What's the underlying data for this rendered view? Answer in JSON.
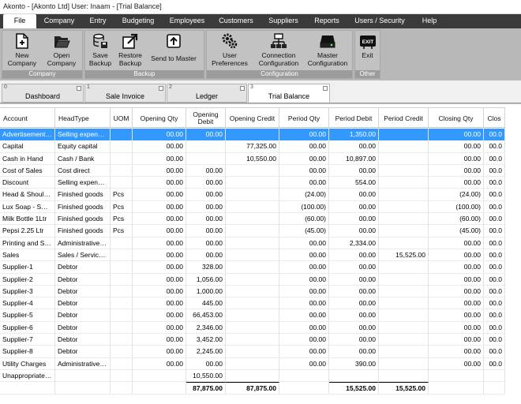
{
  "window": {
    "title": "Akonto - [Akonto Ltd]  User: Inaam - [Trial Balance]"
  },
  "menu": [
    {
      "label": "File",
      "active": true
    },
    {
      "label": "Company"
    },
    {
      "label": "Entry"
    },
    {
      "label": "Budgeting"
    },
    {
      "label": "Employees"
    },
    {
      "label": "Customers"
    },
    {
      "label": "Suppliers"
    },
    {
      "label": "Reports"
    },
    {
      "label": "Users / Security"
    },
    {
      "label": "Help"
    }
  ],
  "ribbon": {
    "groups": [
      {
        "caption": "Company",
        "buttons": [
          {
            "label": "New\nCompany",
            "icon": "new-company-icon"
          },
          {
            "label": "Open\nCompany",
            "icon": "open-folder-icon"
          }
        ]
      },
      {
        "caption": "Backup",
        "buttons": [
          {
            "label": "Save\nBackup",
            "icon": "database-save-icon"
          },
          {
            "label": "Restore\nBackup",
            "icon": "restore-arrow-icon"
          },
          {
            "label": "Send to Master",
            "icon": "send-upload-icon"
          }
        ]
      },
      {
        "caption": "Configuration",
        "buttons": [
          {
            "label": "User\nPreferences",
            "icon": "gears-icon"
          },
          {
            "label": "Connection\nConfiguration",
            "icon": "network-icon"
          },
          {
            "label": "Master\nConfiguration",
            "icon": "server-icon"
          }
        ]
      },
      {
        "caption": "Other",
        "buttons": [
          {
            "label": "Exit",
            "icon": "exit-sign-icon",
            "badge": "EXIT"
          }
        ]
      }
    ]
  },
  "tabs": [
    {
      "num": "0",
      "label": "Dashboard"
    },
    {
      "num": "1",
      "label": "Sale Invoice"
    },
    {
      "num": "2",
      "label": "Ledger"
    },
    {
      "num": "3",
      "label": "Trial Balance",
      "active": true
    }
  ],
  "grid": {
    "columns": [
      "Account",
      "HeadType",
      "UOM",
      "Opening Qty",
      "Opening\nDebit",
      "Opening Credit",
      "Period Qty",
      "Period Debit",
      "Period Credit",
      "Closing Qty",
      "Clos"
    ],
    "rows": [
      [
        "Advertisement Ex...",
        "Selling expenses",
        "",
        "00.00",
        "00.00",
        "",
        "00.00",
        "1,350.00",
        "",
        "00.00",
        "00.0"
      ],
      [
        "Capital",
        "Equity capital",
        "",
        "00.00",
        "",
        "77,325.00",
        "00.00",
        "00.00",
        "",
        "00.00",
        "00.0"
      ],
      [
        "Cash in Hand",
        "Cash / Bank",
        "",
        "00.00",
        "",
        "10,550.00",
        "00.00",
        "10,897.00",
        "",
        "00.00",
        "00.0"
      ],
      [
        "Cost of Sales",
        "Cost direct",
        "",
        "00.00",
        "00.00",
        "",
        "00.00",
        "00.00",
        "",
        "00.00",
        "00.0"
      ],
      [
        "Discount",
        "Selling expenses",
        "",
        "00.00",
        "00.00",
        "",
        "00.00",
        "554.00",
        "",
        "00.00",
        "00.0"
      ],
      [
        "Head & Shoulder...",
        "Finished goods",
        "Pcs",
        "00.00",
        "00.00",
        "",
        "(24.00)",
        "00.00",
        "",
        "(24.00)",
        "00.0"
      ],
      [
        "Lux Soap - Small",
        "Finished goods",
        "Pcs",
        "00.00",
        "00.00",
        "",
        "(100.00)",
        "00.00",
        "",
        "(100.00)",
        "00.0"
      ],
      [
        "Milk Bottle 1Ltr",
        "Finished goods",
        "Pcs",
        "00.00",
        "00.00",
        "",
        "(60.00)",
        "00.00",
        "",
        "(60.00)",
        "00.0"
      ],
      [
        "Pepsi 2.25 Ltr",
        "Finished goods",
        "Pcs",
        "00.00",
        "00.00",
        "",
        "(45.00)",
        "00.00",
        "",
        "(45.00)",
        "00.0"
      ],
      [
        "Printing and Stati...",
        "Administrative ex...",
        "",
        "00.00",
        "00.00",
        "",
        "00.00",
        "2,334.00",
        "",
        "00.00",
        "00.0"
      ],
      [
        "Sales",
        "Sales / Service i...",
        "",
        "00.00",
        "00.00",
        "",
        "00.00",
        "00.00",
        "15,525.00",
        "00.00",
        "00.0"
      ],
      [
        "Supplier-1",
        "Debtor",
        "",
        "00.00",
        "328.00",
        "",
        "00.00",
        "00.00",
        "",
        "00.00",
        "00.0"
      ],
      [
        "Supplier-2",
        "Debtor",
        "",
        "00.00",
        "1,056.00",
        "",
        "00.00",
        "00.00",
        "",
        "00.00",
        "00.0"
      ],
      [
        "Supplier-3",
        "Debtor",
        "",
        "00.00",
        "1,000.00",
        "",
        "00.00",
        "00.00",
        "",
        "00.00",
        "00.0"
      ],
      [
        "Supplier-4",
        "Debtor",
        "",
        "00.00",
        "445.00",
        "",
        "00.00",
        "00.00",
        "",
        "00.00",
        "00.0"
      ],
      [
        "Supplier-5",
        "Debtor",
        "",
        "00.00",
        "66,453.00",
        "",
        "00.00",
        "00.00",
        "",
        "00.00",
        "00.0"
      ],
      [
        "Supplier-6",
        "Debtor",
        "",
        "00.00",
        "2,346.00",
        "",
        "00.00",
        "00.00",
        "",
        "00.00",
        "00.0"
      ],
      [
        "Supplier-7",
        "Debtor",
        "",
        "00.00",
        "3,452.00",
        "",
        "00.00",
        "00.00",
        "",
        "00.00",
        "00.0"
      ],
      [
        "Supplier-8",
        "Debtor",
        "",
        "00.00",
        "2,245.00",
        "",
        "00.00",
        "00.00",
        "",
        "00.00",
        "00.0"
      ],
      [
        "Utility Charges",
        "Administrative ex...",
        "",
        "00.00",
        "00.00",
        "",
        "00.00",
        "390.00",
        "",
        "00.00",
        "00.0"
      ],
      [
        "Unappropriated P...",
        "",
        "",
        "",
        "10,550.00",
        "",
        "",
        "",
        "",
        "",
        ""
      ]
    ],
    "selected_row": 0,
    "totals": [
      "",
      "",
      "",
      "",
      "87,875.00",
      "87,875.00",
      "",
      "15,525.00",
      "15,525.00",
      "",
      ""
    ]
  },
  "colors": {
    "menu_bg": "#3b3b3b",
    "ribbon_bg": "#b8b8b8",
    "group_caption_bg": "#9c9c9c",
    "selection": "#3399ff"
  }
}
